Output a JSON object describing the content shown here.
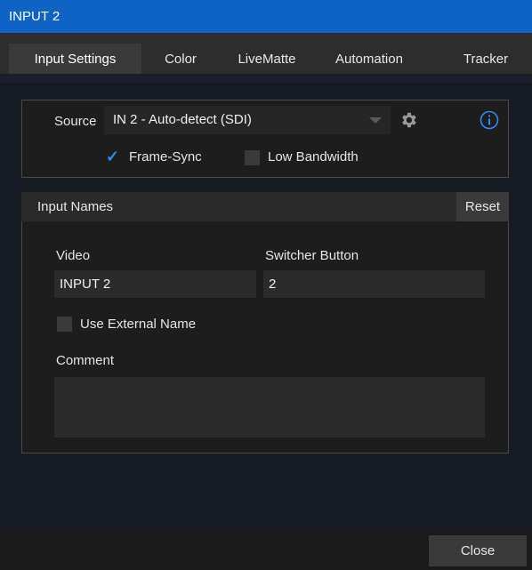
{
  "window": {
    "title": "INPUT 2"
  },
  "tabs": [
    {
      "label": "Input Settings",
      "active": true
    },
    {
      "label": "Color",
      "active": false
    },
    {
      "label": "LiveMatte",
      "active": false
    },
    {
      "label": "Automation",
      "active": false
    },
    {
      "label": "Tracker",
      "active": false
    }
  ],
  "source": {
    "label": "Source",
    "value": "IN 2 - Auto-detect (SDI)",
    "settings_icon": "gear-icon",
    "info_icon": "info-icon",
    "frame_sync": {
      "label": "Frame-Sync",
      "checked": true
    },
    "low_bandwidth": {
      "label": "Low Bandwidth",
      "checked": false
    }
  },
  "input_names": {
    "header": "Input Names",
    "reset_label": "Reset",
    "video_label": "Video",
    "video_value": "INPUT 2",
    "switcher_label": "Switcher Button",
    "switcher_value": "2",
    "use_external": {
      "label": "Use External Name",
      "checked": false
    },
    "comment_label": "Comment",
    "comment_value": ""
  },
  "footer": {
    "close_label": "Close"
  },
  "colors": {
    "accent": "#0f63c4",
    "check": "#2f8cf0"
  }
}
